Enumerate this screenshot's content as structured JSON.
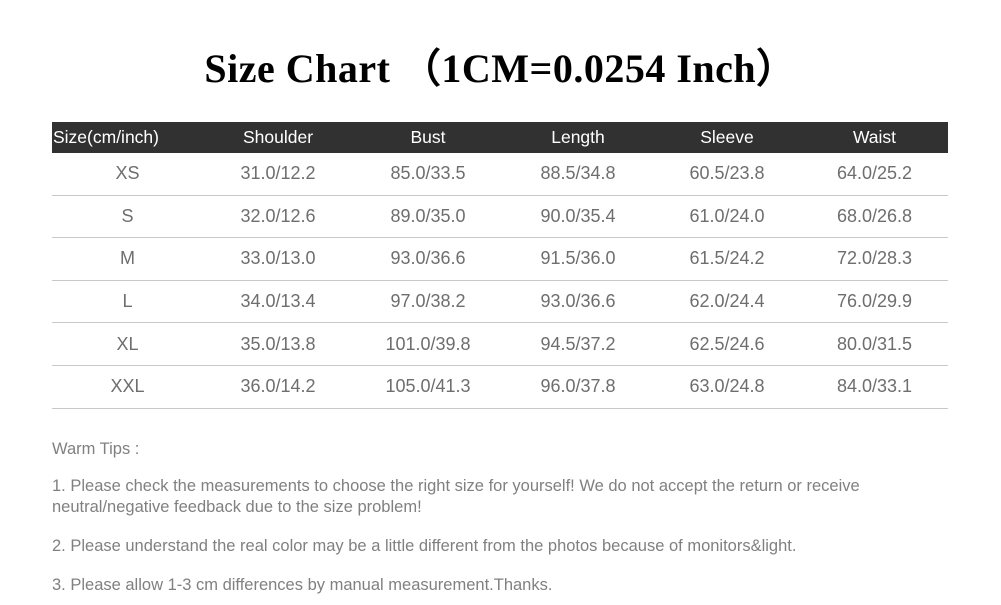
{
  "title": "Size Chart （1CM=0.0254 Inch）",
  "table": {
    "headers": [
      "Size(cm/inch)",
      "Shoulder",
      "Bust",
      "Length",
      "Sleeve",
      "Waist"
    ],
    "rows": [
      {
        "size": "XS",
        "shoulder": "31.0/12.2",
        "bust": "85.0/33.5",
        "length": "88.5/34.8",
        "sleeve": "60.5/23.8",
        "waist": "64.0/25.2"
      },
      {
        "size": "S",
        "shoulder": "32.0/12.6",
        "bust": "89.0/35.0",
        "length": "90.0/35.4",
        "sleeve": "61.0/24.0",
        "waist": "68.0/26.8"
      },
      {
        "size": "M",
        "shoulder": "33.0/13.0",
        "bust": "93.0/36.6",
        "length": "91.5/36.0",
        "sleeve": "61.5/24.2",
        "waist": "72.0/28.3"
      },
      {
        "size": "L",
        "shoulder": "34.0/13.4",
        "bust": "97.0/38.2",
        "length": "93.0/36.6",
        "sleeve": "62.0/24.4",
        "waist": "76.0/29.9"
      },
      {
        "size": "XL",
        "shoulder": "35.0/13.8",
        "bust": "101.0/39.8",
        "length": "94.5/37.2",
        "sleeve": "62.5/24.6",
        "waist": "80.0/31.5"
      },
      {
        "size": "XXL",
        "shoulder": "36.0/14.2",
        "bust": "105.0/41.3",
        "length": "96.0/37.8",
        "sleeve": "63.0/24.8",
        "waist": "84.0/33.1"
      }
    ]
  },
  "tips": {
    "heading": "Warm Tips :",
    "lines": [
      "1. Please check the measurements to choose the right size for yourself! We do not accept the return or receive neutral/negative feedback due to the size problem!",
      "2. Please understand the real color may be a little different from the photos because of monitors&light.",
      "3. Please allow 1-3 cm differences by manual measurement.Thanks."
    ]
  },
  "colors": {
    "header_background": "#313131",
    "header_text": "#ffffff",
    "cell_text": "#6e6e6e",
    "tips_text": "#808080",
    "rule": "#c9c9c9",
    "title_text": "#000000",
    "page_background": "#ffffff"
  }
}
